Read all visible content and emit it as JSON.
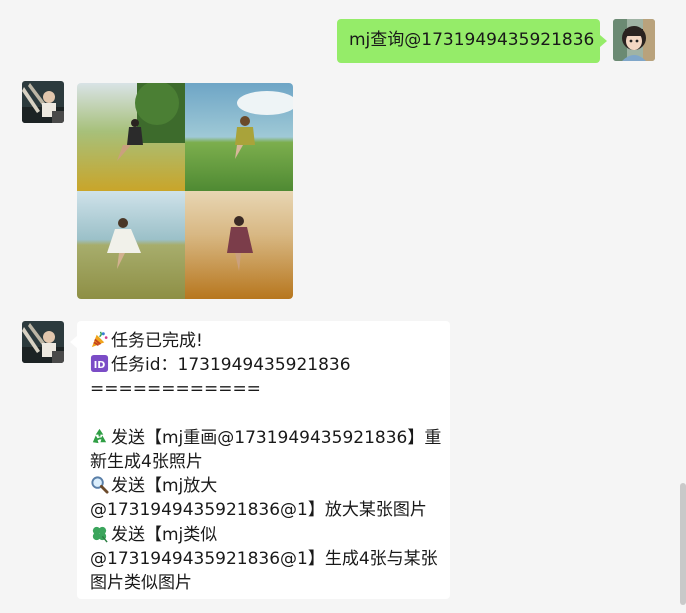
{
  "messages": {
    "outgoing_query": "mj查询@1731949435921836",
    "image_message": "generated-image-grid",
    "result": {
      "lines": [
        "任务已完成!",
        "任务id：1731949435921836",
        "============",
        "",
        "发送【mj重画@1731949435921836】重",
        "新生成4张照片",
        "发送【mj放大",
        "@1731949435921836@1】放大某张图片",
        "发送【mj类似",
        "@1731949435921836@1】生成4张与某张",
        "图片类似图片"
      ],
      "line_icons": [
        "party-popper-icon",
        "id-icon",
        "",
        "",
        "recycle-icon",
        "",
        "magnifier-icon",
        "",
        "clover-icon",
        "",
        ""
      ]
    }
  },
  "colors": {
    "background": "#f5f5f5",
    "outgoing_bubble": "#95ec69",
    "incoming_bubble": "#ffffff"
  }
}
